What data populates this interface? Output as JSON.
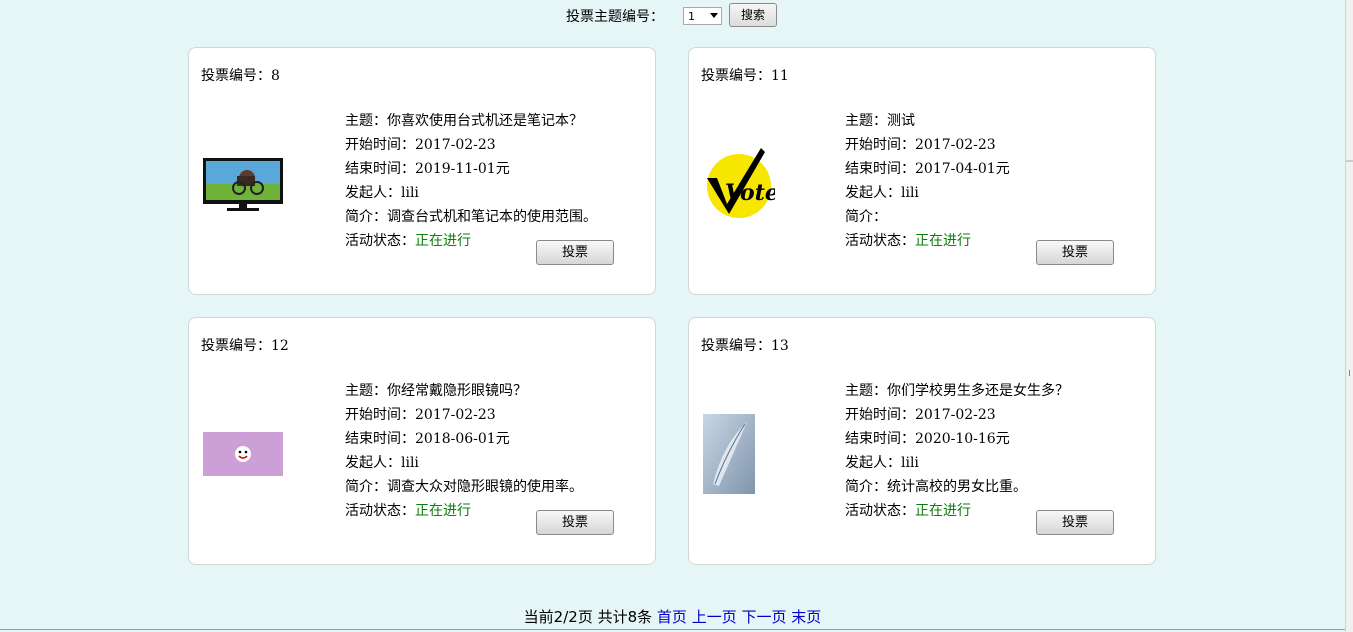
{
  "search": {
    "label": "投票主题编号：",
    "selected_value": "1",
    "button_label": "搜索"
  },
  "labels": {
    "vote_id": "投票编号：",
    "subject": "主题：",
    "start": "开始时间：",
    "end": "结束时间：",
    "initiator": "发起人：",
    "intro": "简介：",
    "status": "活动状态：",
    "vote_button": "投票"
  },
  "cards": [
    {
      "id": "8",
      "subject": "你喜欢使用台式机还是笔记本？",
      "start": "2017-02-23",
      "end": "2019-11-01元",
      "initiator": "lili",
      "intro": "调查台式机和笔记本的使用范围。",
      "status": "正在进行",
      "image": "monitor-image"
    },
    {
      "id": "11",
      "subject": "测试",
      "start": "2017-02-23",
      "end": "2017-04-01元",
      "initiator": "lili",
      "intro": "",
      "status": "正在进行",
      "image": "vote-logo-image",
      "image_text": "Vote"
    },
    {
      "id": "12",
      "subject": "你经常戴隐形眼镜吗？",
      "start": "2017-02-23",
      "end": "2018-06-01元",
      "initiator": "lili",
      "intro": "调查大众对隐形眼镜的使用率。",
      "status": "正在进行",
      "image": "pink-emoji-image"
    },
    {
      "id": "13",
      "subject": "你们学校男生多还是女生多？",
      "start": "2017-02-23",
      "end": "2020-10-16元",
      "initiator": "lili",
      "intro": "统计高校的男女比重。",
      "status": "正在进行",
      "image": "feather-image"
    }
  ],
  "pager": {
    "info": "当前2/2页 共计8条",
    "first": "首页",
    "prev": "上一页",
    "next": "下一页",
    "last": "末页"
  },
  "colors": {
    "background": "#e6f5f5",
    "status": "#0a7f0a",
    "link": "#0000cc"
  }
}
